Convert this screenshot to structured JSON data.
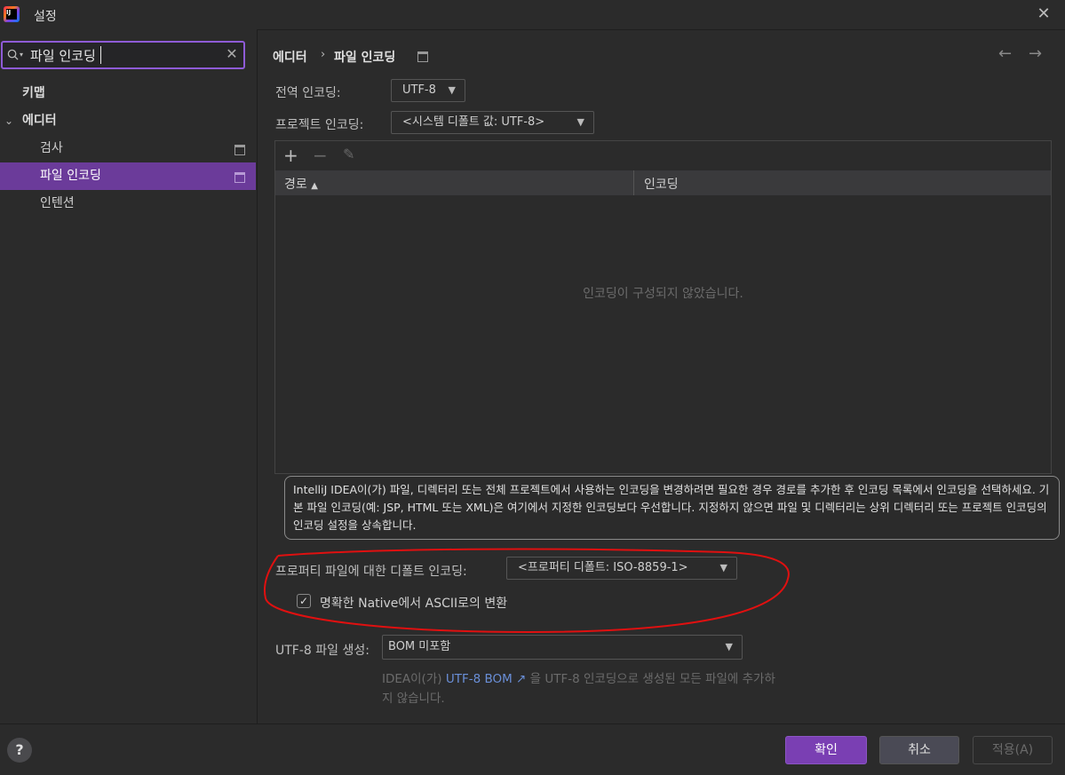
{
  "window": {
    "title": "설정",
    "app_logo_text": "IJ"
  },
  "search": {
    "value": "파일 인코딩"
  },
  "sidebar": {
    "items": [
      {
        "label": "키맵"
      },
      {
        "label": "에디터"
      },
      {
        "label": "검사"
      },
      {
        "label": "파일 인코딩"
      },
      {
        "label": "인텐션"
      }
    ]
  },
  "breadcrumb": {
    "parent": "에디터",
    "current": "파일 인코딩"
  },
  "form": {
    "global_encoding_label": "전역 인코딩:",
    "global_encoding_value": "UTF-8",
    "project_encoding_label": "프로젝트 인코딩:",
    "project_encoding_value": "<시스템 디폴트 값: UTF-8>",
    "table": {
      "col_path": "경로",
      "col_encoding": "인코딩",
      "empty_text": "인코딩이 구성되지 않았습니다."
    },
    "info_text": "IntelliJ IDEA이(가) 파일, 디렉터리 또는 전체 프로젝트에서 사용하는 인코딩을 변경하려면 필요한 경우 경로를 추가한 후 인코딩 목록에서 인코딩을 선택하세요. 기본 파일 인코딩(예: JSP, HTML 또는 XML)은 여기에서 지정한 인코딩보다 우선합니다. 지정하지 않으면 파일 및 디렉터리는 상위 디렉터리 또는 프로젝트 인코딩의 인코딩 설정을 상속합니다.",
    "properties_label": "프로퍼티 파일에 대한 디폴트 인코딩:",
    "properties_value": "<프로퍼티 디폴트: ISO-8859-1>",
    "native_to_ascii_label": "명확한 Native에서 ASCII로의 변환",
    "native_to_ascii_checked": true,
    "bom_label": "UTF-8 파일 생성:",
    "bom_value": "BOM 미포함",
    "bom_help_prefix": "IDEA이(가) ",
    "bom_help_link": "UTF-8 BOM ↗",
    "bom_help_suffix": " 을 UTF-8 인코딩으로 생성된 모든 파일에 추가하",
    "bom_help_line2": "지 않습니다."
  },
  "footer": {
    "help": "?",
    "ok": "확인",
    "cancel": "취소",
    "apply": "적용(A)"
  },
  "colors": {
    "accent": "#7a3fb3",
    "selection": "#6b3b9a",
    "annotation_red": "#e01010",
    "link": "#6a8fd8"
  }
}
